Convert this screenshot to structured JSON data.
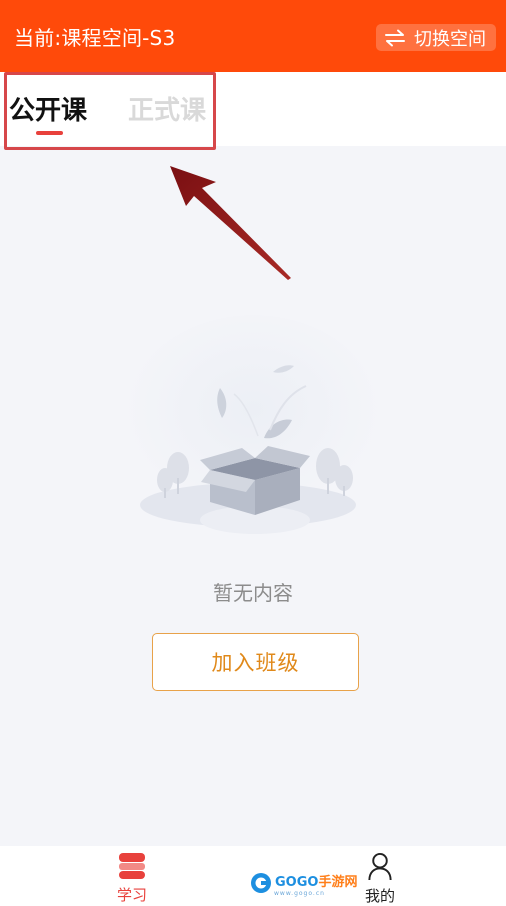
{
  "header": {
    "title": "当前:课程空间-S3",
    "switch_label": "切换空间",
    "background_color": "#ff4a0a"
  },
  "tabs": {
    "items": [
      {
        "label": "公开课",
        "active": true
      },
      {
        "label": "正式课",
        "active": false
      }
    ],
    "accent_color": "#e8413c"
  },
  "empty_state": {
    "icon": "empty-box-illustration",
    "text": "暂无内容",
    "button_label": "加入班级"
  },
  "bottom_nav": {
    "items": [
      {
        "label": "学习",
        "icon": "study-icon",
        "active": true
      },
      {
        "label": "我的",
        "icon": "user-icon",
        "active": false
      }
    ]
  },
  "watermark": {
    "text_part1": "GOGO",
    "text_part2": "手游网",
    "sub_text": "www.gogo.cn"
  }
}
